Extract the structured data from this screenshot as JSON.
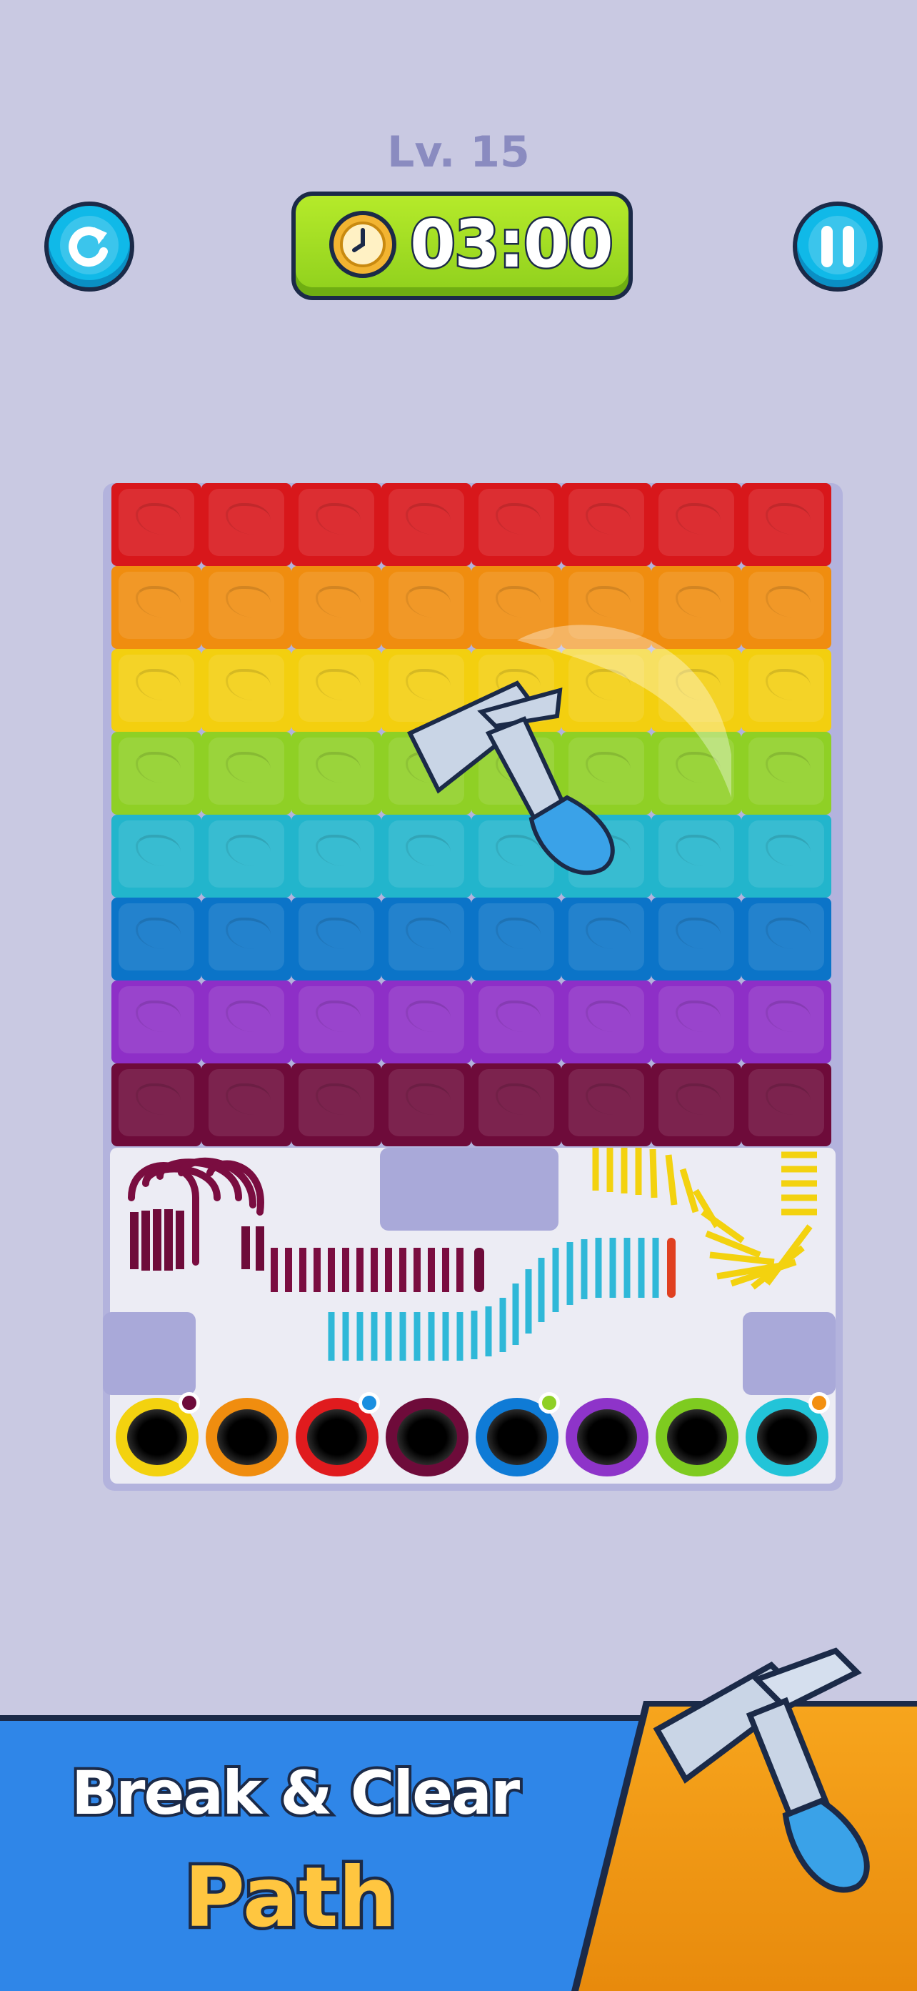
{
  "hud": {
    "level": "Lv. 15",
    "timer": "03:00",
    "restart_icon": "restart-icon",
    "pause_icon": "pause-icon",
    "clock_icon": "clock-icon"
  },
  "board": {
    "row_colors": [
      "#d8171b",
      "#f08d0f",
      "#f3cf0f",
      "#8fd025",
      "#22b5cc",
      "#0b74c8",
      "#8e2fc7",
      "#6e0b3a"
    ],
    "hole_colors": [
      "#f3d20f",
      "#f08d0f",
      "#e01b1e",
      "#6e0b3a",
      "#0f7bd6",
      "#8e34c9",
      "#7ecb20",
      "#22c4d8"
    ],
    "hole_dot_colors": [
      "#6e0b3a",
      null,
      "#1a8fe0",
      null,
      "#8fd025",
      null,
      null,
      "#f39010"
    ],
    "springs": [
      "maroon-spring",
      "cyan-spring",
      "yellow-spring"
    ],
    "tool": "hammer-icon"
  },
  "banner": {
    "line1": "Break & Clear",
    "line2": "Path",
    "tool_icon": "hammer-icon"
  }
}
